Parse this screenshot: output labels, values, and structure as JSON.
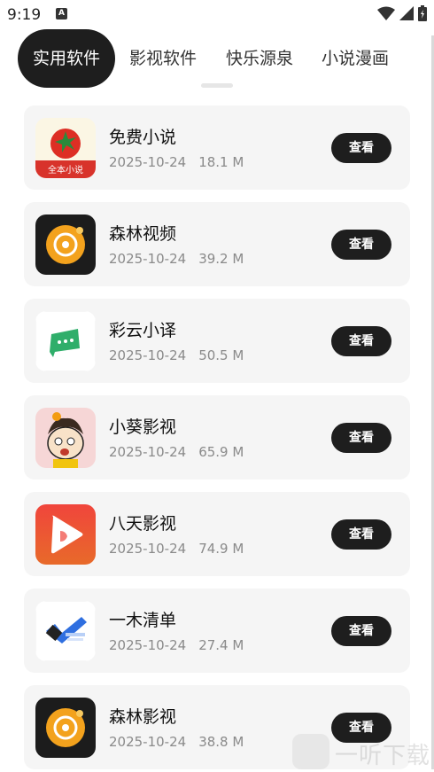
{
  "status_bar": {
    "time": "9:19",
    "notification_icon": "a-icon",
    "icons": [
      "wifi-icon",
      "signal-icon",
      "battery-icon"
    ]
  },
  "tabs": [
    {
      "label": "实用软件",
      "active": true
    },
    {
      "label": "影视软件",
      "active": false
    },
    {
      "label": "快乐源泉",
      "active": false
    },
    {
      "label": "小说漫画",
      "active": false
    }
  ],
  "apps": [
    {
      "name": "免费小说",
      "date": "2025-10-24",
      "size": "18.1 M",
      "button": "查看",
      "icon": "tomato-novel-icon",
      "caption": "全本小说"
    },
    {
      "name": "森林视频",
      "date": "2025-10-24",
      "size": "39.2 M",
      "button": "查看",
      "icon": "forest-video-icon"
    },
    {
      "name": "彩云小译",
      "date": "2025-10-24",
      "size": "50.5 M",
      "button": "查看",
      "icon": "caiyun-translate-icon"
    },
    {
      "name": "小葵影视",
      "date": "2025-10-24",
      "size": "65.9 M",
      "button": "查看",
      "icon": "cartoon-avatar-icon"
    },
    {
      "name": "八天影视",
      "date": "2025-10-24",
      "size": "74.9 M",
      "button": "查看",
      "icon": "play-triangle-icon"
    },
    {
      "name": "一木清单",
      "date": "2025-10-24",
      "size": "27.4 M",
      "button": "查看",
      "icon": "checkmark-list-icon"
    },
    {
      "name": "森林影视",
      "date": "2025-10-24",
      "size": "38.8 M",
      "button": "查看",
      "icon": "forest-video-icon"
    }
  ],
  "watermark": {
    "text": "一听下载"
  },
  "colors": {
    "accent": "#1e1e1e",
    "card_bg": "#f5f5f5",
    "meta_text": "#8a8a8a"
  }
}
